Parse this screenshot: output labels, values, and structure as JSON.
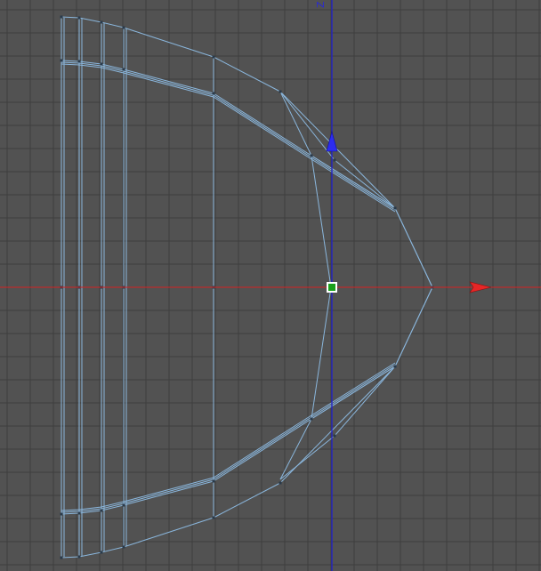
{
  "viewport": {
    "view": "front-orthographic",
    "background": "#525252",
    "grid_color": "#3e3e3e",
    "mesh_color": "#8ab6dc",
    "vertex_color": "#2a3a4a",
    "x_axis_color": "#d42222",
    "z_axis_color": "#2222cc",
    "pivot_color": "#1aa01a",
    "z_axis_label": "Z"
  }
}
